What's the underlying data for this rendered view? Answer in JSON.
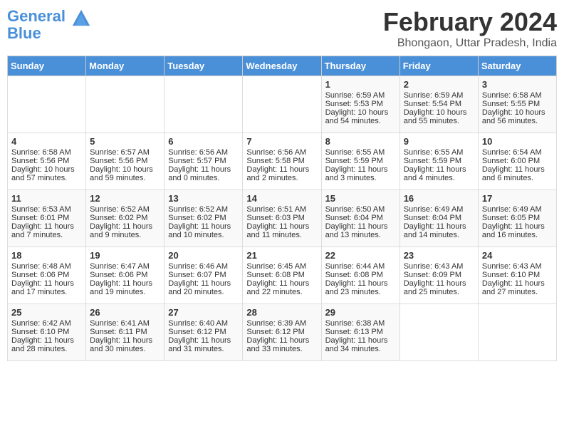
{
  "header": {
    "logo_line1": "General",
    "logo_line2": "Blue",
    "month_year": "February 2024",
    "location": "Bhongaon, Uttar Pradesh, India"
  },
  "days_of_week": [
    "Sunday",
    "Monday",
    "Tuesday",
    "Wednesday",
    "Thursday",
    "Friday",
    "Saturday"
  ],
  "weeks": [
    [
      {
        "day": "",
        "sunrise": "",
        "sunset": "",
        "daylight": ""
      },
      {
        "day": "",
        "sunrise": "",
        "sunset": "",
        "daylight": ""
      },
      {
        "day": "",
        "sunrise": "",
        "sunset": "",
        "daylight": ""
      },
      {
        "day": "",
        "sunrise": "",
        "sunset": "",
        "daylight": ""
      },
      {
        "day": "1",
        "sunrise": "Sunrise: 6:59 AM",
        "sunset": "Sunset: 5:53 PM",
        "daylight": "Daylight: 10 hours and 54 minutes."
      },
      {
        "day": "2",
        "sunrise": "Sunrise: 6:59 AM",
        "sunset": "Sunset: 5:54 PM",
        "daylight": "Daylight: 10 hours and 55 minutes."
      },
      {
        "day": "3",
        "sunrise": "Sunrise: 6:58 AM",
        "sunset": "Sunset: 5:55 PM",
        "daylight": "Daylight: 10 hours and 56 minutes."
      }
    ],
    [
      {
        "day": "4",
        "sunrise": "Sunrise: 6:58 AM",
        "sunset": "Sunset: 5:56 PM",
        "daylight": "Daylight: 10 hours and 57 minutes."
      },
      {
        "day": "5",
        "sunrise": "Sunrise: 6:57 AM",
        "sunset": "Sunset: 5:56 PM",
        "daylight": "Daylight: 10 hours and 59 minutes."
      },
      {
        "day": "6",
        "sunrise": "Sunrise: 6:56 AM",
        "sunset": "Sunset: 5:57 PM",
        "daylight": "Daylight: 11 hours and 0 minutes."
      },
      {
        "day": "7",
        "sunrise": "Sunrise: 6:56 AM",
        "sunset": "Sunset: 5:58 PM",
        "daylight": "Daylight: 11 hours and 2 minutes."
      },
      {
        "day": "8",
        "sunrise": "Sunrise: 6:55 AM",
        "sunset": "Sunset: 5:59 PM",
        "daylight": "Daylight: 11 hours and 3 minutes."
      },
      {
        "day": "9",
        "sunrise": "Sunrise: 6:55 AM",
        "sunset": "Sunset: 5:59 PM",
        "daylight": "Daylight: 11 hours and 4 minutes."
      },
      {
        "day": "10",
        "sunrise": "Sunrise: 6:54 AM",
        "sunset": "Sunset: 6:00 PM",
        "daylight": "Daylight: 11 hours and 6 minutes."
      }
    ],
    [
      {
        "day": "11",
        "sunrise": "Sunrise: 6:53 AM",
        "sunset": "Sunset: 6:01 PM",
        "daylight": "Daylight: 11 hours and 7 minutes."
      },
      {
        "day": "12",
        "sunrise": "Sunrise: 6:52 AM",
        "sunset": "Sunset: 6:02 PM",
        "daylight": "Daylight: 11 hours and 9 minutes."
      },
      {
        "day": "13",
        "sunrise": "Sunrise: 6:52 AM",
        "sunset": "Sunset: 6:02 PM",
        "daylight": "Daylight: 11 hours and 10 minutes."
      },
      {
        "day": "14",
        "sunrise": "Sunrise: 6:51 AM",
        "sunset": "Sunset: 6:03 PM",
        "daylight": "Daylight: 11 hours and 11 minutes."
      },
      {
        "day": "15",
        "sunrise": "Sunrise: 6:50 AM",
        "sunset": "Sunset: 6:04 PM",
        "daylight": "Daylight: 11 hours and 13 minutes."
      },
      {
        "day": "16",
        "sunrise": "Sunrise: 6:49 AM",
        "sunset": "Sunset: 6:04 PM",
        "daylight": "Daylight: 11 hours and 14 minutes."
      },
      {
        "day": "17",
        "sunrise": "Sunrise: 6:49 AM",
        "sunset": "Sunset: 6:05 PM",
        "daylight": "Daylight: 11 hours and 16 minutes."
      }
    ],
    [
      {
        "day": "18",
        "sunrise": "Sunrise: 6:48 AM",
        "sunset": "Sunset: 6:06 PM",
        "daylight": "Daylight: 11 hours and 17 minutes."
      },
      {
        "day": "19",
        "sunrise": "Sunrise: 6:47 AM",
        "sunset": "Sunset: 6:06 PM",
        "daylight": "Daylight: 11 hours and 19 minutes."
      },
      {
        "day": "20",
        "sunrise": "Sunrise: 6:46 AM",
        "sunset": "Sunset: 6:07 PM",
        "daylight": "Daylight: 11 hours and 20 minutes."
      },
      {
        "day": "21",
        "sunrise": "Sunrise: 6:45 AM",
        "sunset": "Sunset: 6:08 PM",
        "daylight": "Daylight: 11 hours and 22 minutes."
      },
      {
        "day": "22",
        "sunrise": "Sunrise: 6:44 AM",
        "sunset": "Sunset: 6:08 PM",
        "daylight": "Daylight: 11 hours and 23 minutes."
      },
      {
        "day": "23",
        "sunrise": "Sunrise: 6:43 AM",
        "sunset": "Sunset: 6:09 PM",
        "daylight": "Daylight: 11 hours and 25 minutes."
      },
      {
        "day": "24",
        "sunrise": "Sunrise: 6:43 AM",
        "sunset": "Sunset: 6:10 PM",
        "daylight": "Daylight: 11 hours and 27 minutes."
      }
    ],
    [
      {
        "day": "25",
        "sunrise": "Sunrise: 6:42 AM",
        "sunset": "Sunset: 6:10 PM",
        "daylight": "Daylight: 11 hours and 28 minutes."
      },
      {
        "day": "26",
        "sunrise": "Sunrise: 6:41 AM",
        "sunset": "Sunset: 6:11 PM",
        "daylight": "Daylight: 11 hours and 30 minutes."
      },
      {
        "day": "27",
        "sunrise": "Sunrise: 6:40 AM",
        "sunset": "Sunset: 6:12 PM",
        "daylight": "Daylight: 11 hours and 31 minutes."
      },
      {
        "day": "28",
        "sunrise": "Sunrise: 6:39 AM",
        "sunset": "Sunset: 6:12 PM",
        "daylight": "Daylight: 11 hours and 33 minutes."
      },
      {
        "day": "29",
        "sunrise": "Sunrise: 6:38 AM",
        "sunset": "Sunset: 6:13 PM",
        "daylight": "Daylight: 11 hours and 34 minutes."
      },
      {
        "day": "",
        "sunrise": "",
        "sunset": "",
        "daylight": ""
      },
      {
        "day": "",
        "sunrise": "",
        "sunset": "",
        "daylight": ""
      }
    ]
  ]
}
